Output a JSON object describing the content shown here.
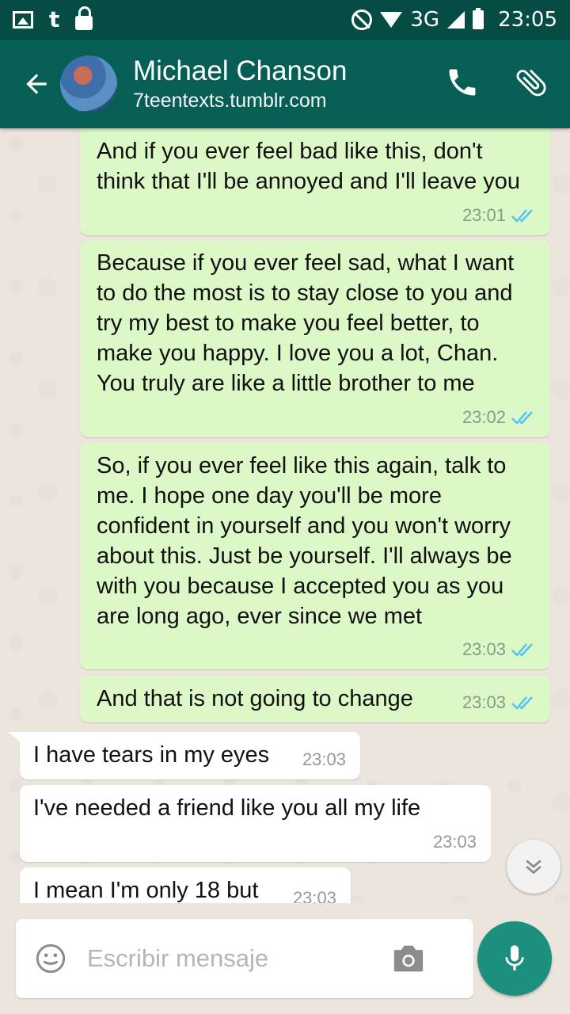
{
  "status_bar": {
    "network": "3G",
    "time": "23:05"
  },
  "header": {
    "contact_name": "Michael Chanson",
    "subtitle": "7teentexts.tumblr.com"
  },
  "messages": [
    {
      "direction": "out",
      "text": "And if you ever feel bad like this, don't think that I'll be annoyed and I'll leave you",
      "time": "23:01",
      "status": "read"
    },
    {
      "direction": "out",
      "text": "Because if you ever feel sad, what I want to do the most is to stay close to you and try my best to make you feel better, to make you happy. I love you a lot, Chan. You truly are like a little brother to me",
      "time": "23:02",
      "status": "read"
    },
    {
      "direction": "out",
      "text": "So, if you ever feel like this again, talk to me. I hope one day you'll be more confident in yourself and you won't worry about this. Just be yourself. I'll always be with you because I accepted you as you are long ago, ever since we met",
      "time": "23:03",
      "status": "read"
    },
    {
      "direction": "out",
      "text": "And that is not going to change",
      "time": "23:03",
      "status": "read"
    },
    {
      "direction": "in",
      "text": "I have tears in my eyes",
      "time": "23:03"
    },
    {
      "direction": "in",
      "text": "I've needed a friend like you all my life",
      "time": "23:03"
    },
    {
      "direction": "in",
      "text": "I mean I'm only 18 but",
      "time": "23:03"
    }
  ],
  "composer": {
    "placeholder": "Escribir mensaje"
  },
  "colors": {
    "header": "#075e54",
    "status_bar": "#054d44",
    "outgoing_bubble": "#dcf8c6",
    "incoming_bubble": "#ffffff",
    "read_ticks": "#4fc3f7",
    "mic_button": "#1c8f7f"
  },
  "icons": [
    "gallery-icon",
    "tumblr-icon",
    "lock-icon",
    "do-not-disturb-icon",
    "wifi-icon",
    "signal-icon",
    "battery-icon",
    "back-arrow-icon",
    "phone-icon",
    "attach-icon",
    "chevron-down-icon",
    "emoji-icon",
    "camera-icon",
    "mic-icon"
  ]
}
